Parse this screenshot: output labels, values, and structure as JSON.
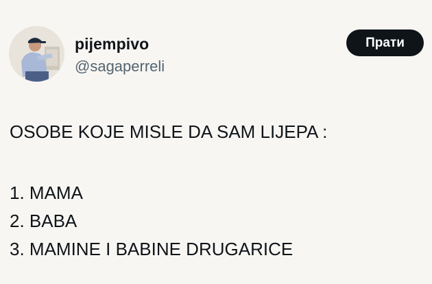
{
  "author": {
    "display_name": "pijempivo",
    "handle": "@sagaperreli",
    "avatar_icon": "user-photo-icon"
  },
  "actions": {
    "follow_label": "Прати"
  },
  "tweet": {
    "lines": [
      "OSOBE KOJE MISLE DA SAM LIJEPA :",
      "1. MAMA",
      "2. BABA",
      "3. MAMINE I BABINE DRUGARICE"
    ]
  },
  "colors": {
    "background": "#f8f6f2",
    "text": "#0f1419",
    "secondary_text": "#536471",
    "button_bg": "#0f1419",
    "button_text": "#ffffff"
  }
}
